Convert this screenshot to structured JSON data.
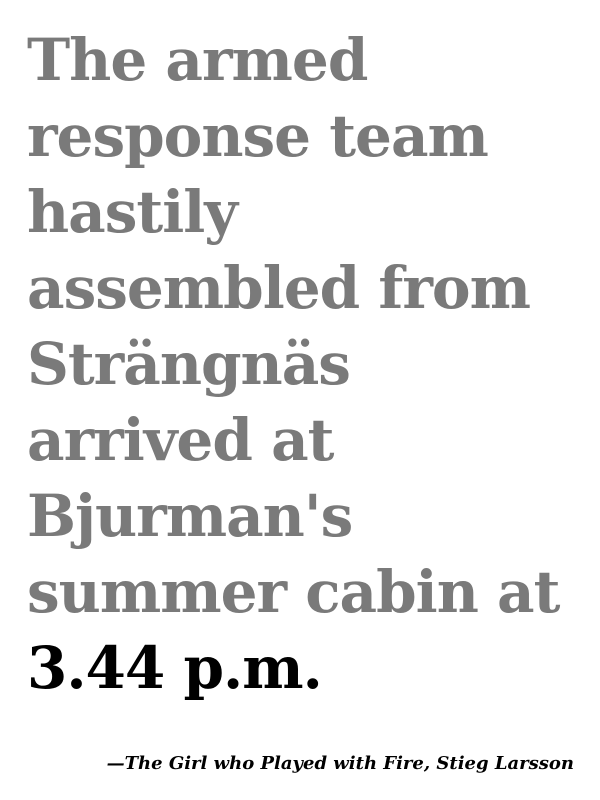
{
  "quote": {
    "lines": [
      "The armed",
      "response team",
      "hastily",
      "assembled from",
      "Strängnäs",
      "arrived at",
      "Bjurman's",
      "summer cabin at",
      "3.44 p.m."
    ],
    "text_color": "#7a7a7a",
    "emphasis_color": "#000000"
  },
  "attribution": {
    "text": "—The Girl who Played with Fire, Stieg Larsson"
  }
}
